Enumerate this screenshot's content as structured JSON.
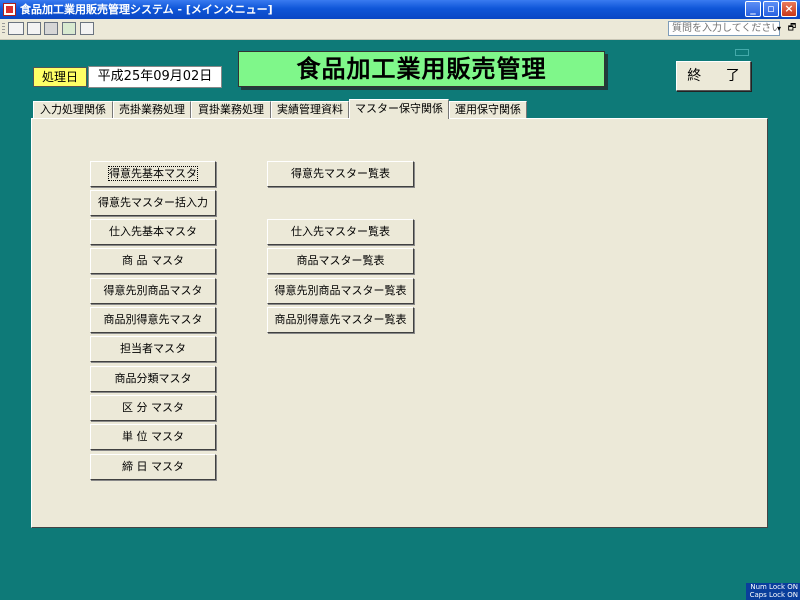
{
  "window": {
    "title": "食品加工業用販売管理システム - [メインメニュー]",
    "minimize_glyph": "_",
    "maximize_glyph": "▫",
    "close_glyph": "×"
  },
  "toolbar": {
    "help_placeholder": "質問を入力してください",
    "dropdown_glyph": "▾",
    "restore_glyph": "🗗"
  },
  "header": {
    "date_label": "処理日",
    "date_value": "平成25年09月02日",
    "app_title": "食品加工業用販売管理",
    "exit_label": "終 了"
  },
  "tabs": [
    {
      "label": "入力処理関係"
    },
    {
      "label": "売掛業務処理"
    },
    {
      "label": "買掛業務処理"
    },
    {
      "label": "実績管理資料"
    },
    {
      "label": "マスター保守関係"
    },
    {
      "label": "運用保守関係"
    }
  ],
  "active_tab": "マスター保守関係",
  "left_buttons": [
    {
      "label": "得意先基本マスタ"
    },
    {
      "label": "得意先マスター括入力"
    },
    {
      "label": "仕入先基本マスタ"
    },
    {
      "label": "商 品 マスタ"
    },
    {
      "label": "得意先別商品マスタ"
    },
    {
      "label": "商品別得意先マスタ"
    },
    {
      "label": "担当者マスタ"
    },
    {
      "label": "商品分類マスタ"
    },
    {
      "label": "区 分 マスタ"
    },
    {
      "label": "単 位 マスタ"
    },
    {
      "label": "締 日 マスタ"
    }
  ],
  "right_buttons": [
    {
      "label": "得意先マスター覧表"
    },
    {
      "label": "仕入先マスター覧表"
    },
    {
      "label": "商品マスター覧表"
    },
    {
      "label": "得意先別商品マスター覧表"
    },
    {
      "label": "商品別得意先マスター覧表"
    }
  ],
  "status": {
    "num_lock": "Num Lock ON",
    "caps_lock": "Caps Lock ON"
  },
  "colors": {
    "background": "#0e7a78",
    "title_bg": "#7ff78a",
    "date_label_bg": "#ffff66",
    "panel_bg": "#ece9d8"
  }
}
